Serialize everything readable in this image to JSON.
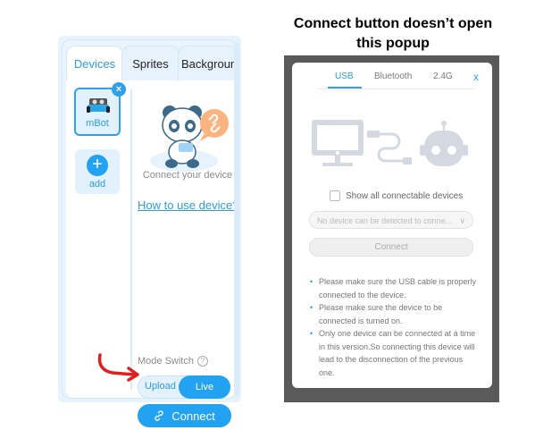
{
  "annotation": {
    "caption": "Connect button doesn’t open this popup",
    "arrow_color": "#e02020"
  },
  "left_panel": {
    "tabs": [
      {
        "label": "Devices",
        "active": true
      },
      {
        "label": "Sprites",
        "active": false
      },
      {
        "label": "Background",
        "active": false
      }
    ],
    "device": {
      "name": "mBot",
      "close_icon": "close-icon"
    },
    "add": {
      "label": "add",
      "icon": "plus-icon"
    },
    "connect_hint": "Connect your device",
    "help_link": "How to use device?",
    "mode_switch": {
      "label": "Mode Switch",
      "help_icon": "question-icon",
      "options": [
        "Upload",
        "Live"
      ],
      "selected": "Live"
    },
    "connect_button": {
      "label": "Connect",
      "icon": "link-icon"
    },
    "accent": "#22a2f0"
  },
  "popup": {
    "tabs": [
      {
        "label": "USB",
        "active": true
      },
      {
        "label": "Bluetooth",
        "active": false
      },
      {
        "label": "2.4G",
        "active": false
      }
    ],
    "close_label": "x",
    "show_all_label": "Show all connectable devices",
    "show_all_checked": false,
    "select_placeholder": "No device can be detected to conne...",
    "connect_label": "Connect",
    "tips": [
      "Please make sure the USB cable is properly connected to the device.",
      "Please make sure the device to be connected is turned on.",
      "Only one device can be connected at a time in this version.So connecting this device will lead to the disconnection of the previous one."
    ]
  }
}
